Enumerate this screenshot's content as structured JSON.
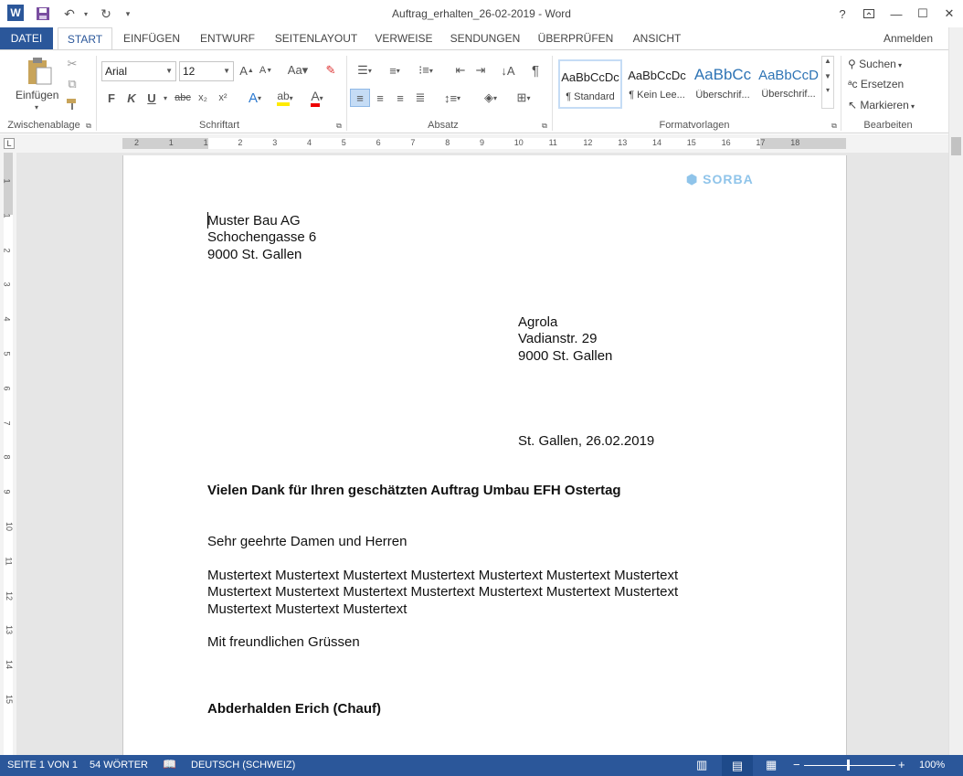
{
  "window": {
    "title": "Auftrag_erhalten_26-02-2019 - Word",
    "help": "?",
    "ribbon_display": "▭",
    "minimize": "—",
    "maximize": "☐",
    "close": "✕",
    "signin": "Anmelden"
  },
  "qat": {
    "word_icon": "W",
    "save_icon": "save-icon",
    "undo_icon": "undo-icon",
    "redo_icon": "redo-icon",
    "customize_icon": "customize-icon"
  },
  "tabs": [
    {
      "label": "DATEI"
    },
    {
      "label": "START"
    },
    {
      "label": "EINFÜGEN"
    },
    {
      "label": "ENTWURF"
    },
    {
      "label": "SEITENLAYOUT"
    },
    {
      "label": "VERWEISE"
    },
    {
      "label": "SENDUNGEN"
    },
    {
      "label": "ÜBERPRÜFEN"
    },
    {
      "label": "ANSICHT"
    }
  ],
  "ribbon": {
    "clipboard": {
      "paste_label": "Einfügen",
      "group": "Zwischenablage"
    },
    "font": {
      "name": "Arial",
      "size": "12",
      "group": "Schriftart"
    },
    "paragraph": {
      "group": "Absatz"
    },
    "styles": {
      "group": "Formatvorlagen",
      "items": [
        {
          "preview": "AaBbCcDc",
          "name": "¶ Standard"
        },
        {
          "preview": "AaBbCcDc",
          "name": "¶ Kein Lee..."
        },
        {
          "preview": "AaBbCc",
          "name": "Überschrif..."
        },
        {
          "preview": "AaBbCcD",
          "name": "Überschrif..."
        }
      ]
    },
    "editing": {
      "search": "Suchen",
      "replace": "Ersetzen",
      "select": "Markieren",
      "group": "Bearbeiten"
    }
  },
  "ruler": {
    "h": [
      "2",
      "1",
      "1",
      "2",
      "3",
      "4",
      "5",
      "6",
      "7",
      "8",
      "9",
      "10",
      "11",
      "12",
      "13",
      "14",
      "15",
      "16",
      "17",
      "18"
    ],
    "v": [
      "1",
      "1",
      "2",
      "3",
      "4",
      "5",
      "6",
      "7",
      "8",
      "9",
      "10",
      "11",
      "12",
      "13",
      "14",
      "15"
    ]
  },
  "document": {
    "logo": "SORBA",
    "sender": [
      "Muster Bau AG",
      "Schochengasse 6",
      "9000 St. Gallen"
    ],
    "recipient": [
      "Agrola",
      "Vadianstr. 29",
      "9000 St. Gallen"
    ],
    "date": "St. Gallen, 26.02.2019",
    "subject": "Vielen Dank für Ihren geschätzten Auftrag Umbau EFH Ostertag",
    "salutation": "Sehr geehrte Damen und Herren",
    "body": [
      "Mustertext Mustertext Mustertext Mustertext Mustertext Mustertext Mustertext",
      "Mustertext Mustertext Mustertext Mustertext Mustertext Mustertext Mustertext",
      "Mustertext Mustertext Mustertext"
    ],
    "closing": "Mit freundlichen Grüssen",
    "signature": "Abderhalden Erich (Chauf)"
  },
  "status": {
    "page": "SEITE 1 VON 1",
    "words": "54 WÖRTER",
    "language": "DEUTSCH (SCHWEIZ)",
    "zoom": "100%"
  },
  "colors": {
    "accent": "#2b579a"
  }
}
